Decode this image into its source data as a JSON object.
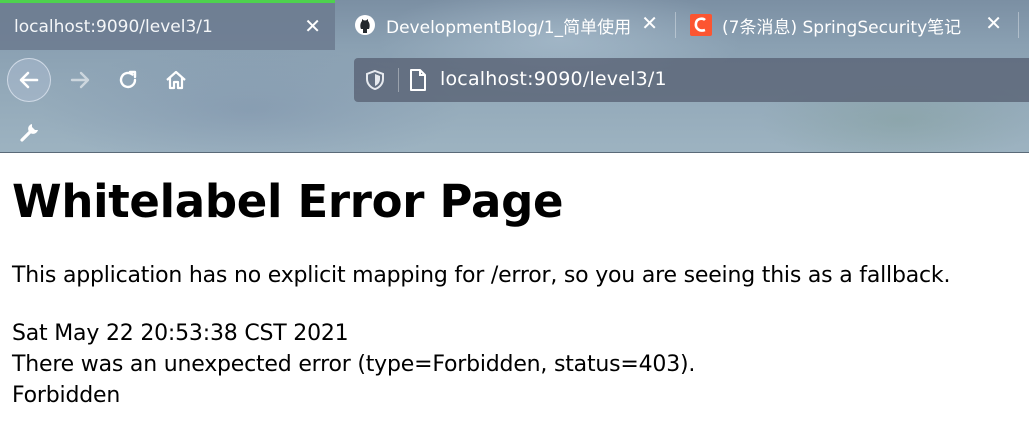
{
  "browser": {
    "tabs": [
      {
        "title": "localhost:9090/level3/1",
        "active": true,
        "favicon": "none"
      },
      {
        "title": "DevelopmentBlog/1_简单使用",
        "active": false,
        "favicon": "github-icon"
      },
      {
        "title": "(7条消息) SpringSecurity笔记",
        "active": false,
        "favicon": "csdn-icon"
      }
    ],
    "close_glyph": "✕",
    "url": "localhost:9090/level3/1",
    "accent_color": "#4ed14e"
  },
  "page": {
    "heading": "Whitelabel Error Page",
    "message": "This application has no explicit mapping for /error, so you are seeing this as a fallback.",
    "timestamp": "Sat May 22 20:53:38 CST 2021",
    "error_line": "There was an unexpected error (type=Forbidden, status=403).",
    "error_message": "Forbidden"
  }
}
